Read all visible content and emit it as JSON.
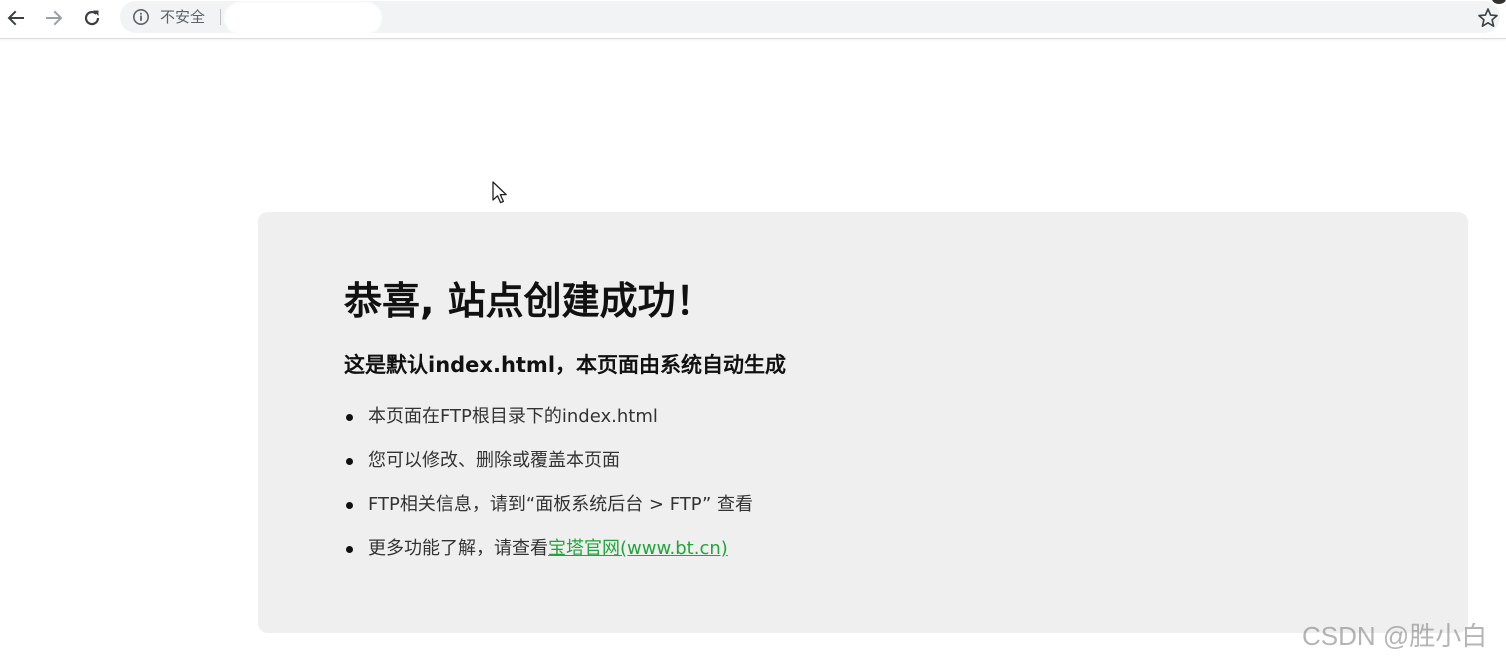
{
  "browser": {
    "security_label": "不安全",
    "url": ""
  },
  "page": {
    "title": "恭喜, 站点创建成功！",
    "subtitle": "这是默认index.html，本页面由系统自动生成",
    "items": [
      {
        "text": "本页面在FTP根目录下的index.html"
      },
      {
        "text": "您可以修改、删除或覆盖本页面"
      },
      {
        "text": "FTP相关信息，请到“面板系统后台 > FTP” 查看"
      },
      {
        "text": "更多功能了解，请查看",
        "link": "宝塔官网(www.bt.cn)"
      }
    ]
  },
  "watermark": "CSDN @胜小白",
  "colors": {
    "card_background": "#efefef",
    "link": "#20a53a",
    "omnibox": "#f1f3f4"
  },
  "icons": {
    "back": "arrow-left-icon",
    "forward": "arrow-right-icon",
    "reload": "reload-icon",
    "info": "info-icon",
    "bookmark": "star-icon",
    "cursor": "mouse-cursor-icon"
  }
}
